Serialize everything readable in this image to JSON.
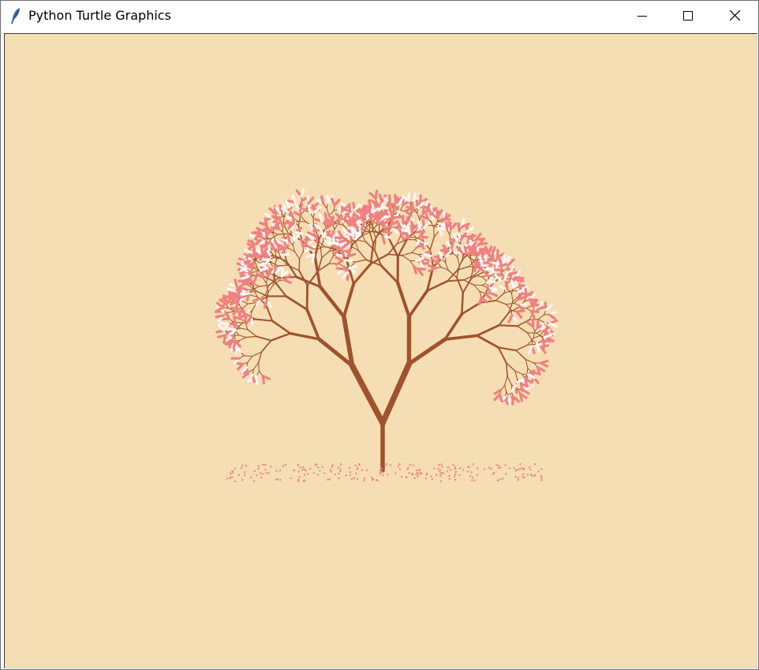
{
  "window": {
    "title": "Python Turtle Graphics",
    "app_icon": "feather-icon",
    "controls": {
      "minimize_icon": "minimize-icon",
      "maximize_icon": "maximize-icon",
      "close_icon": "close-icon"
    }
  },
  "canvas": {
    "background": "#f5deb3",
    "trunk_color": "#a0522d",
    "blossom_pink": "#f08080",
    "blossom_white": "#fff5f5",
    "petal_color": "#f08080"
  }
}
